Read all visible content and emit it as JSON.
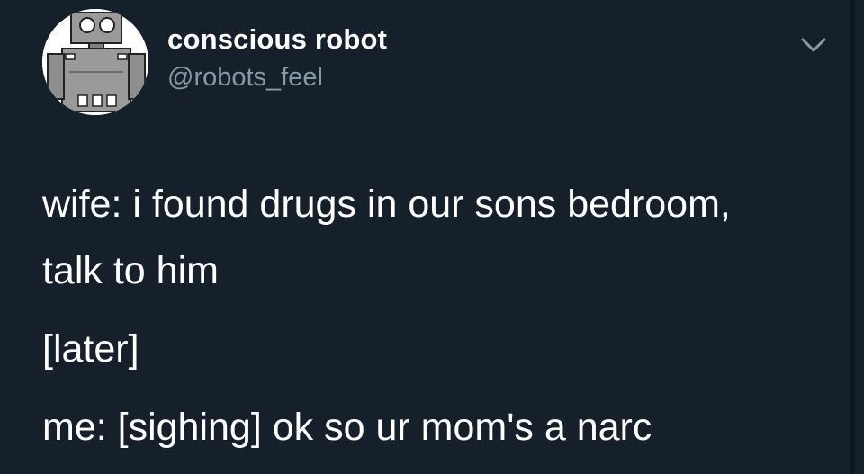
{
  "tweet": {
    "author_name": "conscious robot",
    "author_handle": "@robots_feel",
    "avatar_icon": "robot-avatar-icon",
    "menu_icon": "chevron-down-icon",
    "lines": [
      "wife: i found drugs in our sons bedroom,",
      "talk to him",
      "[later]",
      "me: [sighing] ok so ur mom's a narc"
    ]
  },
  "colors": {
    "background": "#15202b",
    "text_primary": "#ffffff",
    "text_secondary": "#8899a6"
  }
}
